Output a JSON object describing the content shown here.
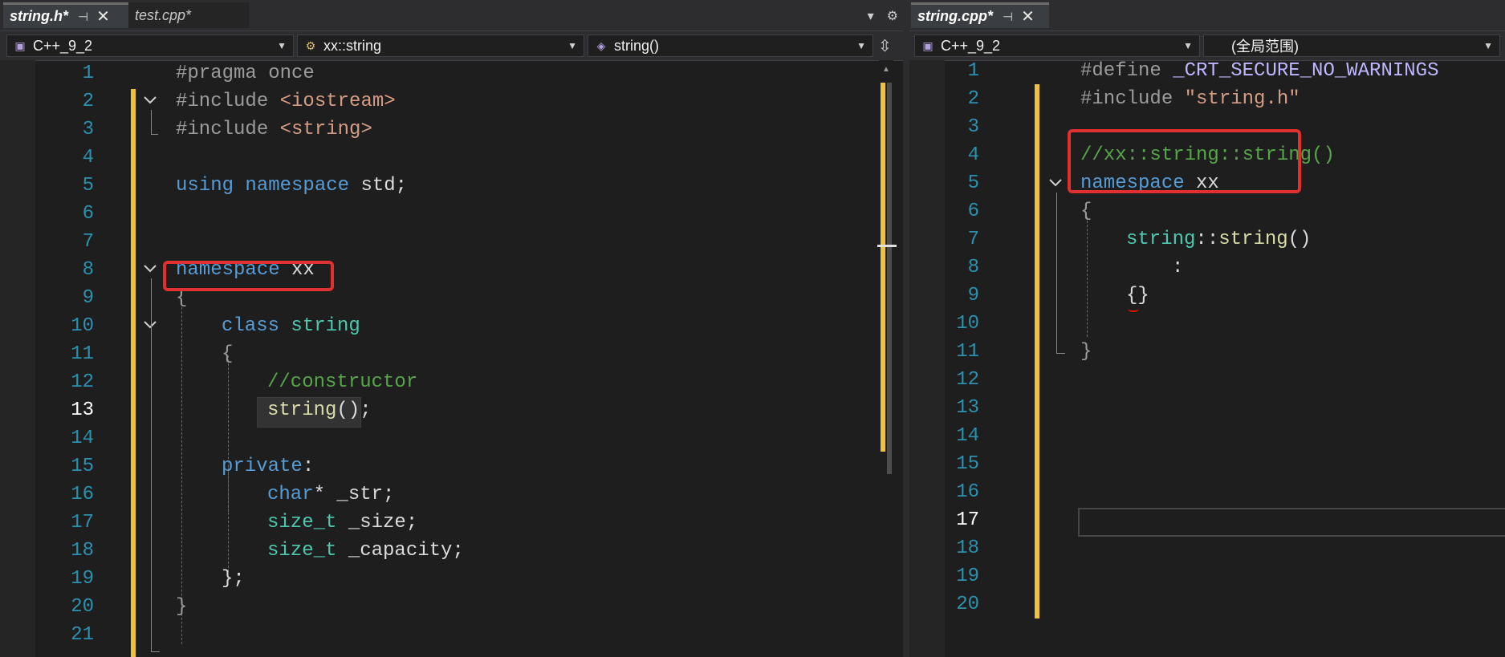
{
  "left": {
    "tabs": [
      {
        "label": "string.h*",
        "active": true
      },
      {
        "label": "test.cpp*",
        "active": false
      }
    ],
    "nav": {
      "project": "C++_9_2",
      "scope": "xx::string",
      "member": "string()"
    },
    "lines": [
      "1",
      "2",
      "3",
      "4",
      "5",
      "6",
      "7",
      "8",
      "9",
      "10",
      "11",
      "12",
      "13",
      "14",
      "15",
      "16",
      "17",
      "18",
      "19",
      "20",
      "21"
    ],
    "current_line": "13",
    "code": {
      "l1": "#pragma once",
      "l2a": "#include ",
      "l2b": "<iostream>",
      "l3a": "#include ",
      "l3b": "<string>",
      "l5a": "using",
      "l5b": "namespace",
      "l5c": "std;",
      "l8a": "namespace",
      "l8b": "xx",
      "l9": "{",
      "l10a": "class",
      "l10b": "string",
      "l11": "{",
      "l12": "//constructor",
      "l13a": "string",
      "l13b": "();",
      "l15a": "private",
      "l15b": ":",
      "l16a": "char",
      "l16b": "* _str;",
      "l17a": "size_t",
      "l17b": " _size;",
      "l18a": "size_t",
      "l18b": " _capacity;",
      "l19": "};",
      "l20": "}"
    }
  },
  "right": {
    "tabs": [
      {
        "label": "string.cpp*",
        "active": true
      }
    ],
    "nav": {
      "project": "C++_9_2",
      "scope": "(全局范围)"
    },
    "lines": [
      "1",
      "2",
      "3",
      "4",
      "5",
      "6",
      "7",
      "8",
      "9",
      "10",
      "11",
      "12",
      "13",
      "14",
      "15",
      "16",
      "17",
      "18",
      "19",
      "20"
    ],
    "current_line": "17",
    "code": {
      "l1a": "#define ",
      "l1b": "_CRT_SECURE_NO_WARNINGS",
      "l2a": "#include ",
      "l2b": "\"string.h\"",
      "l4": "//xx::string::string()",
      "l5a": "namespace",
      "l5b": "xx",
      "l6": "{",
      "l7a": "string",
      "l7b": "::",
      "l7c": "string",
      "l7d": "()",
      "l8": ":",
      "l9": "{}",
      "l11": "}"
    }
  },
  "colors": {
    "keyword": "#569cd6",
    "type": "#4ec9b0",
    "function": "#dcdcaa",
    "string": "#d69d85",
    "comment": "#57a64a",
    "line_number": "#2b91af",
    "highlight_box": "#e0302f",
    "change_bar": "#efc23b"
  }
}
